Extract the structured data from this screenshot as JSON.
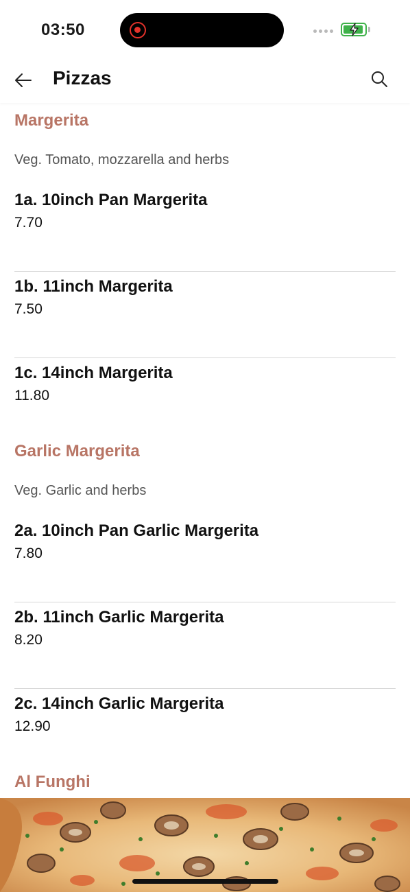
{
  "status_bar": {
    "time": "03:50",
    "battery_color": "#3fb24a",
    "record_color": "#e5322b"
  },
  "header": {
    "title": "Pizzas",
    "back_icon": "arrow-left-icon",
    "search_icon": "search-icon"
  },
  "sections": [
    {
      "title": "Margerita",
      "description": "Veg. Tomato, mozzarella and herbs",
      "items": [
        {
          "name": "1a. 10inch Pan Margerita",
          "price": "7.70"
        },
        {
          "name": "1b. 11inch Margerita",
          "price": "7.50"
        },
        {
          "name": "1c. 14inch Margerita",
          "price": "11.80"
        }
      ]
    },
    {
      "title": "Garlic Margerita",
      "description": "Veg. Garlic and herbs",
      "items": [
        {
          "name": "2a. 10inch Pan Garlic Margerita",
          "price": "7.80"
        },
        {
          "name": "2b. 11inch Garlic Margerita",
          "price": "8.20"
        },
        {
          "name": "2c. 14inch Garlic Margerita",
          "price": "12.90"
        }
      ]
    },
    {
      "title": "Al Funghi"
    }
  ],
  "colors": {
    "accent": "#b87565",
    "divider": "#d6d6d6"
  }
}
